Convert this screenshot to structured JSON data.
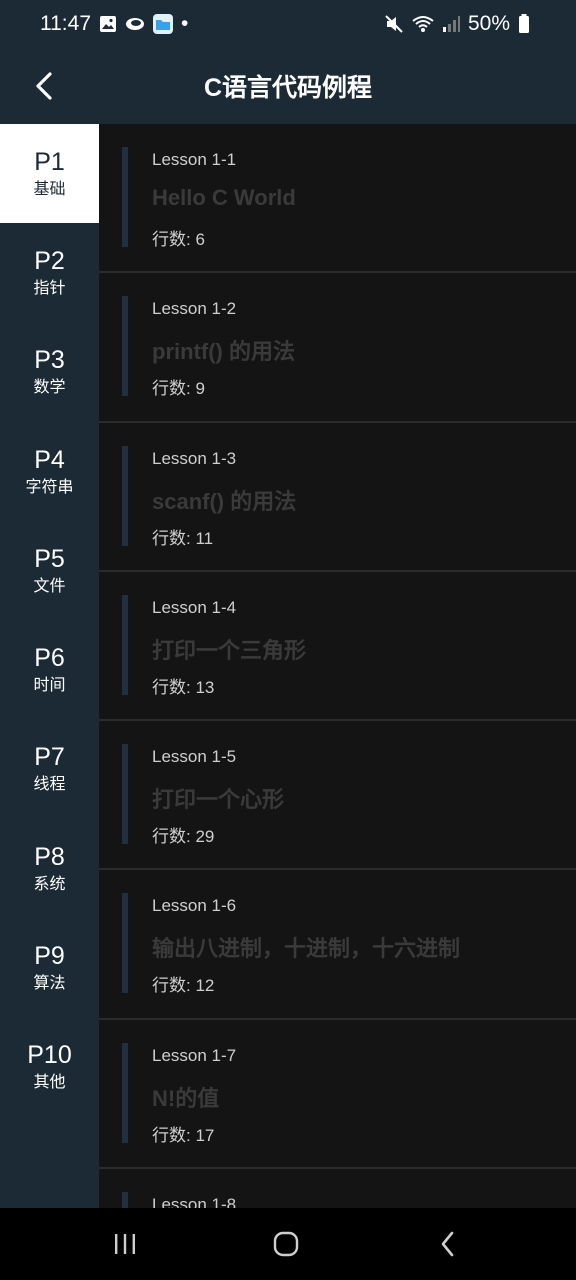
{
  "status_bar": {
    "time": "11:47",
    "dot": "•",
    "battery": "50%"
  },
  "header": {
    "title": "C语言代码例程"
  },
  "sidebar": {
    "items": [
      {
        "code": "P1",
        "name": "基础"
      },
      {
        "code": "P2",
        "name": "指针"
      },
      {
        "code": "P3",
        "name": "数学"
      },
      {
        "code": "P4",
        "name": "字符串"
      },
      {
        "code": "P5",
        "name": "文件"
      },
      {
        "code": "P6",
        "name": "时间"
      },
      {
        "code": "P7",
        "name": "线程"
      },
      {
        "code": "P8",
        "name": "系统"
      },
      {
        "code": "P9",
        "name": "算法"
      },
      {
        "code": "P10",
        "name": "其他"
      }
    ]
  },
  "lessons": [
    {
      "num": "Lesson 1-1",
      "title": "Hello C World",
      "lines": "行数: 6"
    },
    {
      "num": "Lesson 1-2",
      "title": "printf() 的用法",
      "lines": "行数: 9"
    },
    {
      "num": "Lesson 1-3",
      "title": "scanf() 的用法",
      "lines": "行数: 11"
    },
    {
      "num": "Lesson 1-4",
      "title": "打印一个三角形",
      "lines": "行数: 13"
    },
    {
      "num": "Lesson 1-5",
      "title": "打印一个心形",
      "lines": "行数: 29"
    },
    {
      "num": "Lesson 1-6",
      "title": "输出八进制，十进制，十六进制",
      "lines": "行数: 12"
    },
    {
      "num": "Lesson 1-7",
      "title": "N!的值",
      "lines": "行数: 17"
    },
    {
      "num": "Lesson 1-8",
      "title": "",
      "lines": ""
    }
  ]
}
